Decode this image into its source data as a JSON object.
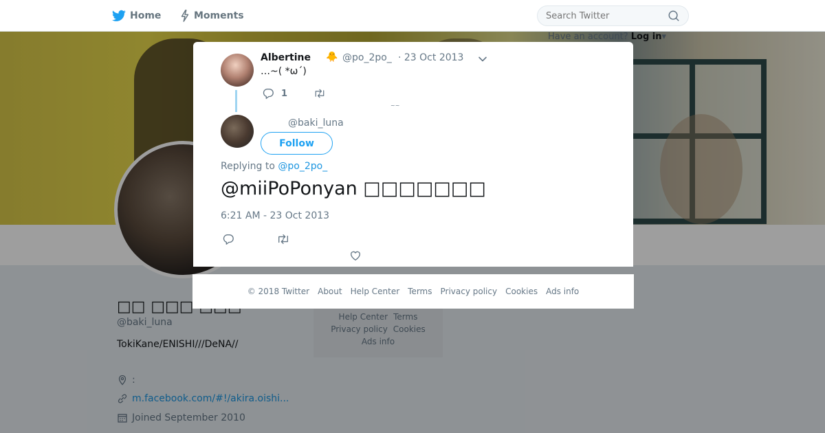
{
  "nav": {
    "home": "Home",
    "moments": "Moments",
    "search_placeholder": "Search Twitter",
    "have_account": "Have an account?",
    "login": "Log in"
  },
  "profile": {
    "name": "□□ □□□ □□□",
    "handle": "@baki_luna",
    "bio": "TokiKane/ENISHI///DeNA//",
    "location": ":",
    "website": "m.facebook.com/#!/akira.oishi...",
    "joined": "Joined September 2010"
  },
  "side_footer": {
    "help_center": "Help Center",
    "terms": "Terms",
    "privacy": "Privacy policy",
    "cookies": "Cookies",
    "ads_info": "Ads info"
  },
  "parent_tweet": {
    "name": "Albertine",
    "emoji": "🐥",
    "handle": "@po_2po_",
    "date": "· 23 Oct 2013",
    "text": "…~( *ω´)",
    "reply_count": "1",
    "mark": "~~"
  },
  "main_tweet": {
    "handle": "@baki_luna",
    "follow": "Follow",
    "replying_to_label": "Replying to",
    "replying_to_handle": "@po_2po_",
    "text": "@miiPoPonyan □□□□□□□",
    "time": "6:21 AM - 23 Oct 2013"
  },
  "footer": {
    "copyright": "© 2018 Twitter",
    "about": "About",
    "help_center": "Help Center",
    "terms": "Terms",
    "privacy": "Privacy policy",
    "cookies": "Cookies",
    "ads_info": "Ads info"
  },
  "icons": {
    "home": "home-bird-icon",
    "moments": "lightning-icon",
    "search": "search-icon",
    "close": "close-icon",
    "reply": "reply-icon",
    "retweet": "retweet-icon",
    "like": "heart-icon",
    "caret": "chevron-down-icon",
    "location": "location-pin-icon",
    "link": "link-icon",
    "calendar": "calendar-icon"
  },
  "colors": {
    "accent": "#1da1f2",
    "link": "#1b95e0",
    "muted": "#657786",
    "thread_line": "#9fd4f1"
  }
}
